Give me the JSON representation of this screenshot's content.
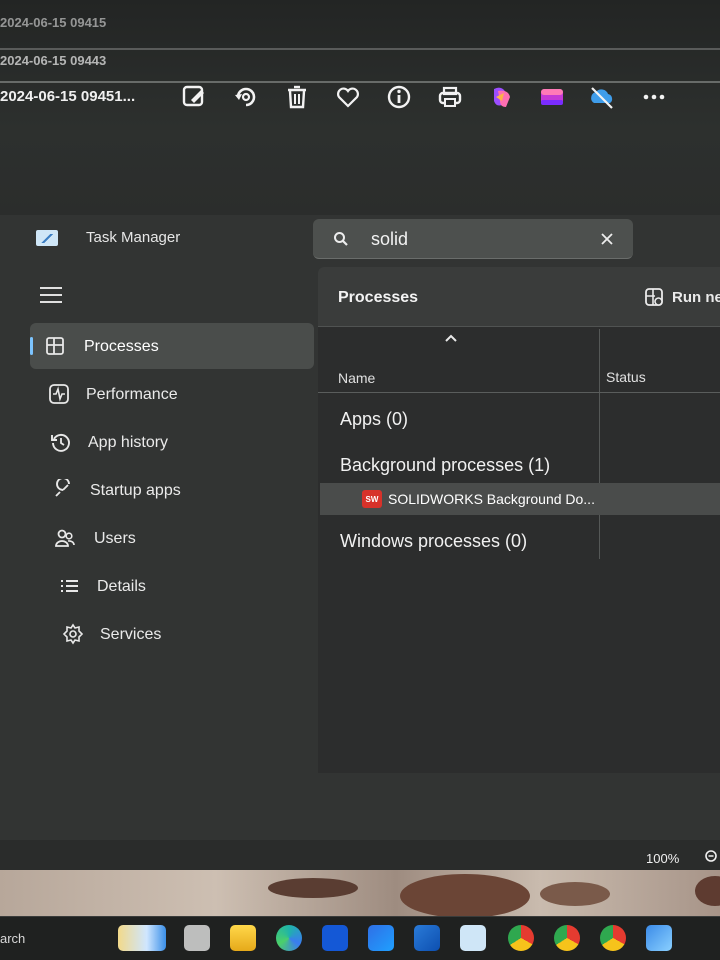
{
  "viewer": {
    "rows": [
      {
        "date": "2024-06-15 09415"
      },
      {
        "date": "2024-06-15 09443"
      },
      {
        "date": "2024-06-15 09451..."
      }
    ],
    "icons": [
      "edit-icon",
      "rotate-icon",
      "delete-icon",
      "favorite-icon",
      "info-icon",
      "print-icon",
      "copilot-icon",
      "clipchamp-icon",
      "onedrive-icon",
      "more-icon"
    ]
  },
  "task_manager": {
    "title": "Task Manager",
    "search": {
      "value": "solid"
    },
    "nav": [
      {
        "label": "Processes",
        "icon": "processes-icon",
        "active": true
      },
      {
        "label": "Performance",
        "icon": "performance-icon"
      },
      {
        "label": "App history",
        "icon": "app-history-icon"
      },
      {
        "label": "Startup apps",
        "icon": "startup-apps-icon"
      },
      {
        "label": "Users",
        "icon": "users-icon"
      },
      {
        "label": "Details",
        "icon": "details-icon"
      },
      {
        "label": "Services",
        "icon": "services-icon"
      }
    ],
    "page_title": "Processes",
    "run_new_task": "Run ne",
    "columns": {
      "name": "Name",
      "status": "Status"
    },
    "groups": {
      "apps": "Apps (0)",
      "background": "Background processes (1)",
      "windows": "Windows processes (0)"
    },
    "process": {
      "name": "SOLIDWORKS Background Do...",
      "badge": "SW"
    },
    "zoom": "100%"
  },
  "taskbar": {
    "search_label": "arch",
    "icons": [
      "widgets-icon",
      "task-view-icon",
      "file-explorer-icon",
      "edge-icon",
      "app-l-icon",
      "app-arrow-icon",
      "outlook-new-icon",
      "task-manager-icon",
      "chrome-icon",
      "chrome-profile-icon",
      "chrome-icon-2",
      "photos-icon"
    ]
  }
}
